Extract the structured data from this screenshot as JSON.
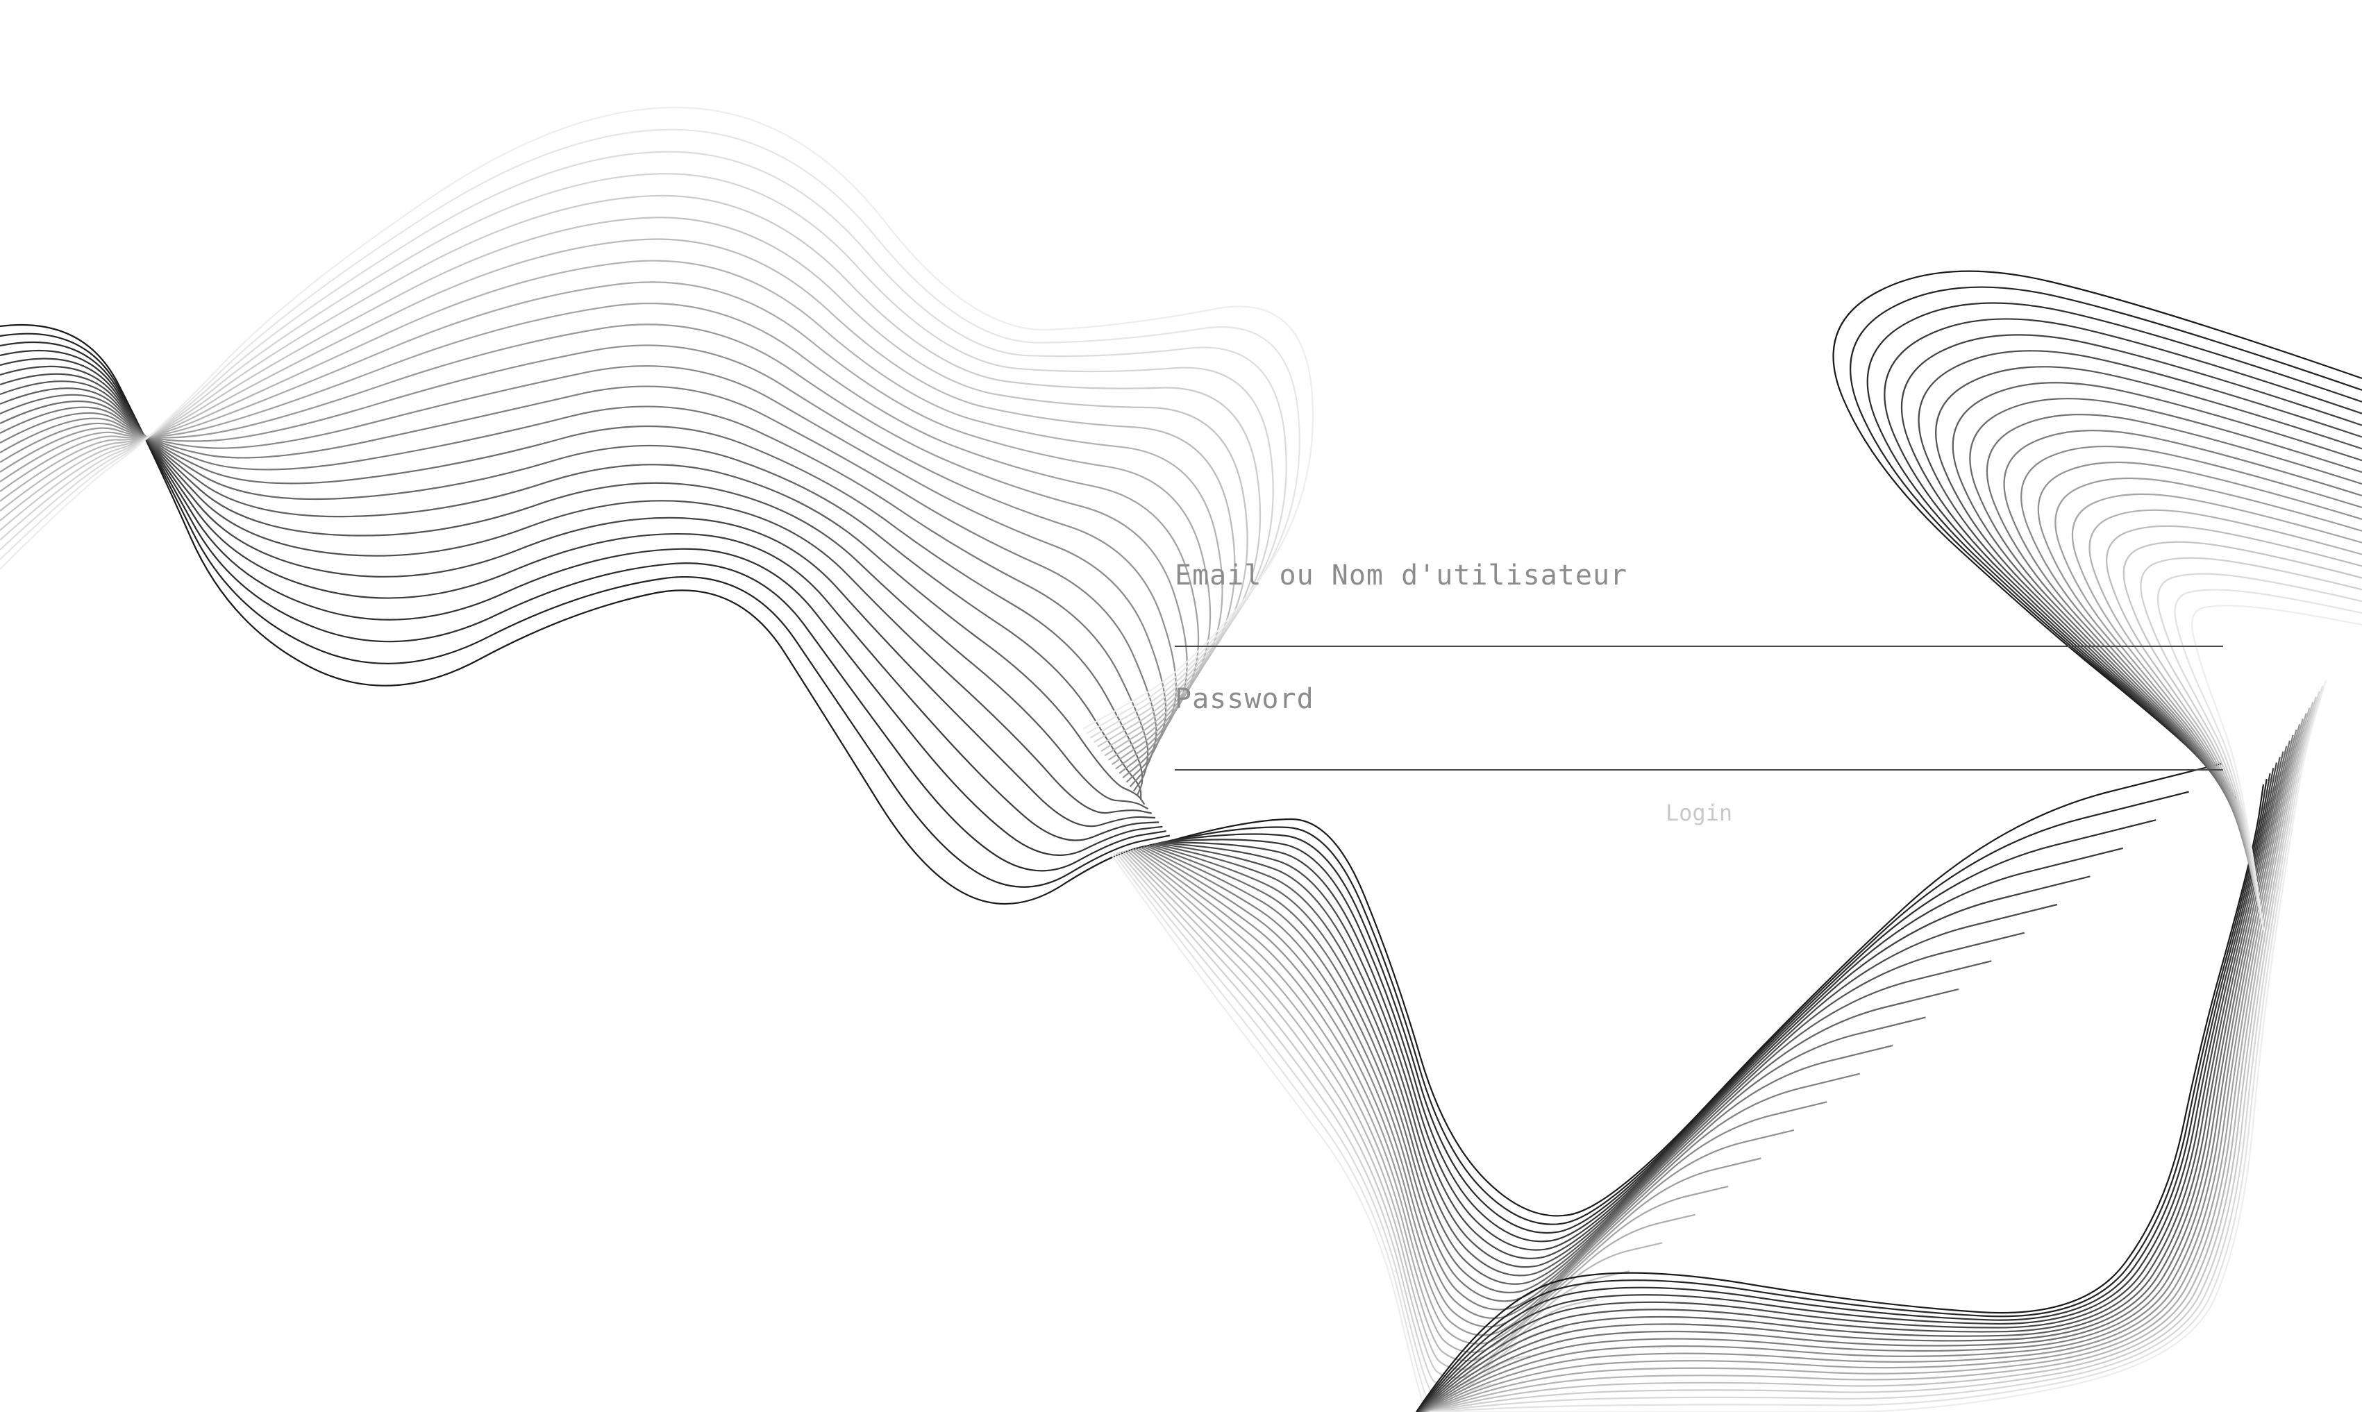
{
  "login": {
    "email_label": "Email ou Nom d'utilisateur",
    "password_label": "Password",
    "submit_label": "Login"
  },
  "colors": {
    "background": "#ffffff",
    "line_dark": "#1a1a1a",
    "line_light": "#ededed",
    "underline": "#4a4a4a",
    "label": "#8c8c8c",
    "button_text": "#c8c8c8"
  }
}
